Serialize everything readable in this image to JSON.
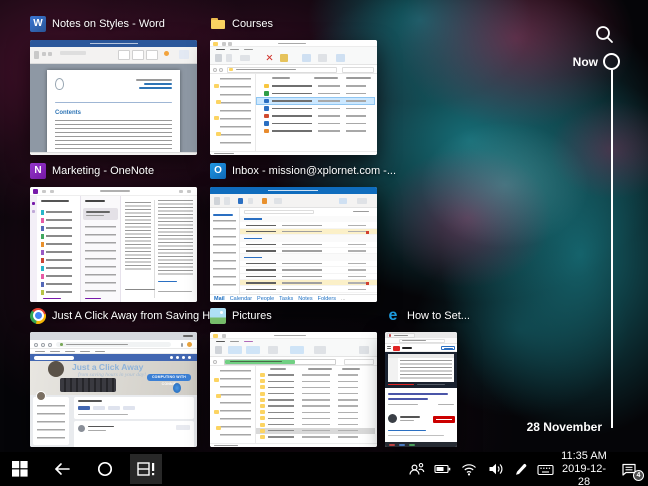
{
  "task_view": {
    "now_label": "Now",
    "date_marker": "28 November"
  },
  "windows": [
    {
      "title": "Notes on Styles - Word"
    },
    {
      "title": "Courses"
    },
    {
      "title": "Marketing - OneNote"
    },
    {
      "title": "Inbox - mission@xplornet.com -..."
    },
    {
      "title": "Just A Click Away from Saving Ho..."
    },
    {
      "title": "Pictures"
    },
    {
      "title": "How to Set..."
    }
  ],
  "word": {
    "contents_label": "Contents"
  },
  "outlook": {
    "nav": [
      "Mail",
      "Calendar",
      "People",
      "Tasks",
      "Notes",
      "Folders",
      "..."
    ]
  },
  "chrome": {
    "banner_title": "Just a Click Away",
    "banner_subtitle": "from saving hours in your day!",
    "banner_badge": "COMPUTING WITH CONNIE"
  },
  "icons": {
    "word_glyph": "W",
    "onenote_glyph": "N",
    "outlook_glyph": "O",
    "edge_glyph": "e"
  },
  "taskbar": {
    "time": "11:35 AM",
    "date": "2019-12-28",
    "notification_count": "4"
  },
  "colors": {
    "word_blue": "#2b579a",
    "onenote_purple": "#7719aa",
    "outlook_blue": "#0f6cbd",
    "facebook_blue": "#4267b2",
    "youtube_red": "#cc0000",
    "edge_blue": "#1e9de0",
    "folder_yellow": "#fcd462",
    "progress_green": "#71d083",
    "selection_blue": "#cce8ff",
    "row_highlight_yellow": "#fbf0c8",
    "timeline_white": "#ffffff",
    "taskbar_background": "#000000"
  }
}
